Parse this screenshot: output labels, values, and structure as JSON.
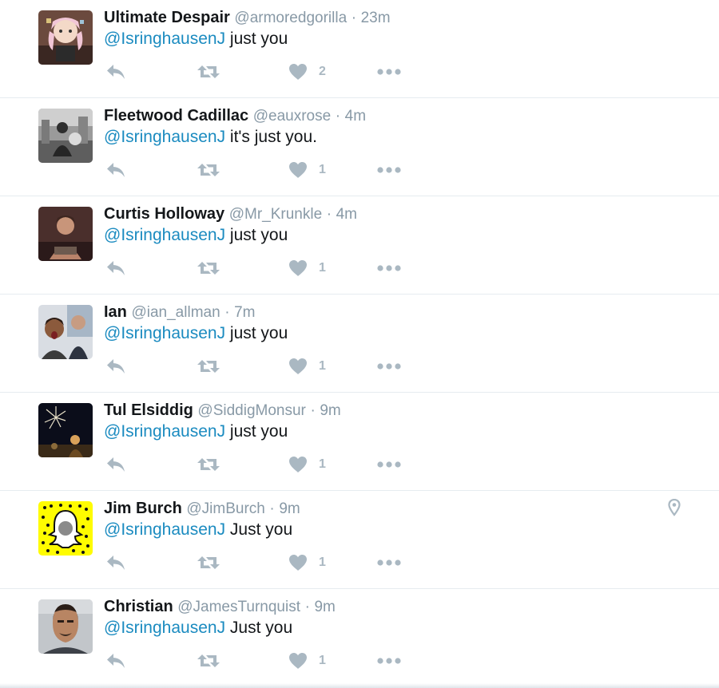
{
  "colors": {
    "mention": "#1b8bc0",
    "muted": "#8899a6",
    "icon": "#aab8c2",
    "name": "#14171a"
  },
  "tweets": [
    {
      "name": "Ultimate Despair",
      "handle": "@armoredgorilla",
      "dot": "·",
      "time": "23m",
      "mention": "@IsringhausenJ",
      "text": "just you",
      "likes": "2",
      "avatar": "anime-character-avatar",
      "location_icon": false
    },
    {
      "name": "Fleetwood Cadillac",
      "handle": "@eauxrose",
      "dot": "·",
      "time": "4m",
      "mention": "@IsringhausenJ",
      "text": "it's just you.",
      "likes": "1",
      "avatar": "black-and-white-photo-avatar",
      "location_icon": false
    },
    {
      "name": "Curtis Holloway",
      "handle": "@Mr_Krunkle",
      "dot": "·",
      "time": "4m",
      "mention": "@IsringhausenJ",
      "text": "just you",
      "likes": "1",
      "avatar": "person-photo-avatar",
      "location_icon": false
    },
    {
      "name": "Ian",
      "handle": "@ian_allman",
      "dot": "·",
      "time": "7m",
      "mention": "@IsringhausenJ",
      "text": "just you",
      "likes": "1",
      "avatar": "selfie-photo-avatar",
      "location_icon": false
    },
    {
      "name": "Tul Elsiddig",
      "handle": "@SiddigMonsur",
      "dot": "·",
      "time": "9m",
      "mention": "@IsringhausenJ",
      "text": "just you",
      "likes": "1",
      "avatar": "fireworks-photo-avatar",
      "location_icon": false
    },
    {
      "name": "Jim Burch",
      "handle": "@JimBurch",
      "dot": "·",
      "time": "9m",
      "mention": "@IsringhausenJ",
      "text": "Just you",
      "likes": "1",
      "avatar": "snapcode-avatar",
      "location_icon": true
    },
    {
      "name": "Christian",
      "handle": "@JamesTurnquist",
      "dot": "·",
      "time": "9m",
      "mention": "@IsringhausenJ",
      "text": "Just you",
      "likes": "1",
      "avatar": "portrait-photo-avatar",
      "location_icon": false
    }
  ]
}
